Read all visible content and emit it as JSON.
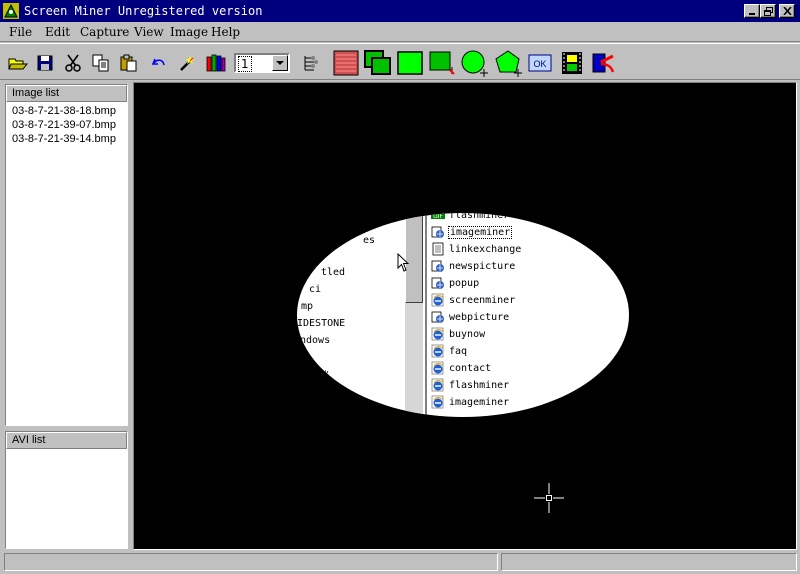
{
  "window": {
    "title": "Screen Miner Unregistered version"
  },
  "menu": {
    "items": [
      "File",
      "Edit",
      "Capture",
      "View",
      "Image",
      "Help"
    ]
  },
  "toolbar": {
    "pen_width_value": "1",
    "icons": [
      "open-icon",
      "save-icon",
      "cut-icon",
      "copy-icon",
      "paste-icon",
      "undo-icon",
      "magic-wand-icon",
      "pencils-icon",
      "pen-width-select",
      "options-icon",
      "capture-fullscreen-icon",
      "capture-window-icon",
      "capture-rectangle-icon",
      "capture-freehand-icon",
      "capture-ellipse-icon",
      "capture-polygon-icon",
      "ok-icon",
      "avi-capture-icon",
      "exit-icon"
    ]
  },
  "image_list": {
    "header": "Image list",
    "items": [
      "03-8-7-21-38-18.bmp",
      "03-8-7-21-39-07.bmp",
      "03-8-7-21-39-14.bmp"
    ]
  },
  "avi_list": {
    "header": "AVI list",
    "items": []
  },
  "capture_preview": {
    "left_fragments": [
      "es",
      "tled",
      "ci",
      "mp",
      "IDESTONE",
      "ndows",
      "档"
    ],
    "folders": [
      {
        "label": "flashminer",
        "icon": "gif-file-icon",
        "selected": false
      },
      {
        "label": "imageminer",
        "icon": "web-folder-icon",
        "selected": true
      },
      {
        "label": "linkexchange",
        "icon": "text-file-icon",
        "selected": false
      },
      {
        "label": "newspicture",
        "icon": "web-folder-icon",
        "selected": false
      },
      {
        "label": "popup",
        "icon": "web-folder-icon",
        "selected": false
      },
      {
        "label": "screenminer",
        "icon": "ie-icon",
        "selected": false
      },
      {
        "label": "webpicture",
        "icon": "web-folder-icon",
        "selected": false
      },
      {
        "label": "buynow",
        "icon": "ie-icon",
        "selected": false
      },
      {
        "label": "faq",
        "icon": "ie-icon",
        "selected": false
      },
      {
        "label": "contact",
        "icon": "ie-icon",
        "selected": false
      },
      {
        "label": "flashminer",
        "icon": "ie-icon",
        "selected": false
      },
      {
        "label": "imageminer",
        "icon": "ie-icon",
        "selected": false
      }
    ]
  },
  "colors": {
    "titlebar": "#00007f",
    "face": "#c0c0c0",
    "viewport": "#000000"
  }
}
